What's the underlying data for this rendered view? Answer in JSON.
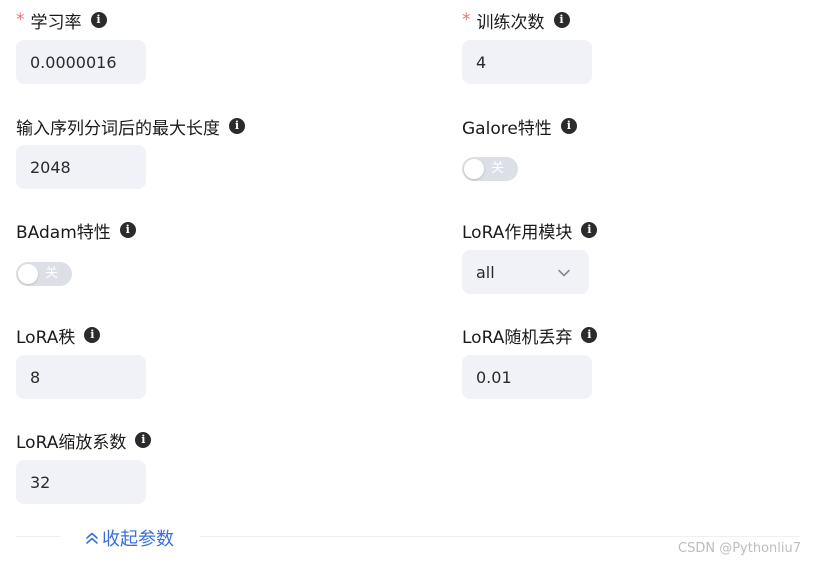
{
  "fields": {
    "learning_rate": {
      "required_mark": "*",
      "label": "学习率",
      "value": "0.0000016"
    },
    "epochs": {
      "required_mark": "*",
      "label": "训练次数",
      "value": "4"
    },
    "cutoff_len": {
      "label": "输入序列分词后的最大长度",
      "value": "2048"
    },
    "galore": {
      "label": "Galore特性",
      "toggle_text": "关",
      "enabled": false
    },
    "badam": {
      "label": "BAdam特性",
      "toggle_text": "关",
      "enabled": false
    },
    "lora_target": {
      "label": "LoRA作用模块",
      "value": "all"
    },
    "lora_rank": {
      "label": "LoRA秩",
      "value": "8"
    },
    "lora_dropout": {
      "label": "LoRA随机丢弃",
      "value": "0.01"
    },
    "lora_alpha": {
      "label": "LoRA缩放系数",
      "value": "32"
    }
  },
  "icons": {
    "info": "info-icon",
    "chevron": "chevron-down-icon",
    "collapse": "chevrons-up-icon"
  },
  "collapse_link": {
    "label": "收起参数"
  },
  "watermark": "CSDN @Pythonliu7",
  "colors": {
    "required": "#f56c6c",
    "input_bg": "#f1f1f8",
    "link": "#3b6fd8",
    "toggle_off": "#dcdfe6"
  }
}
